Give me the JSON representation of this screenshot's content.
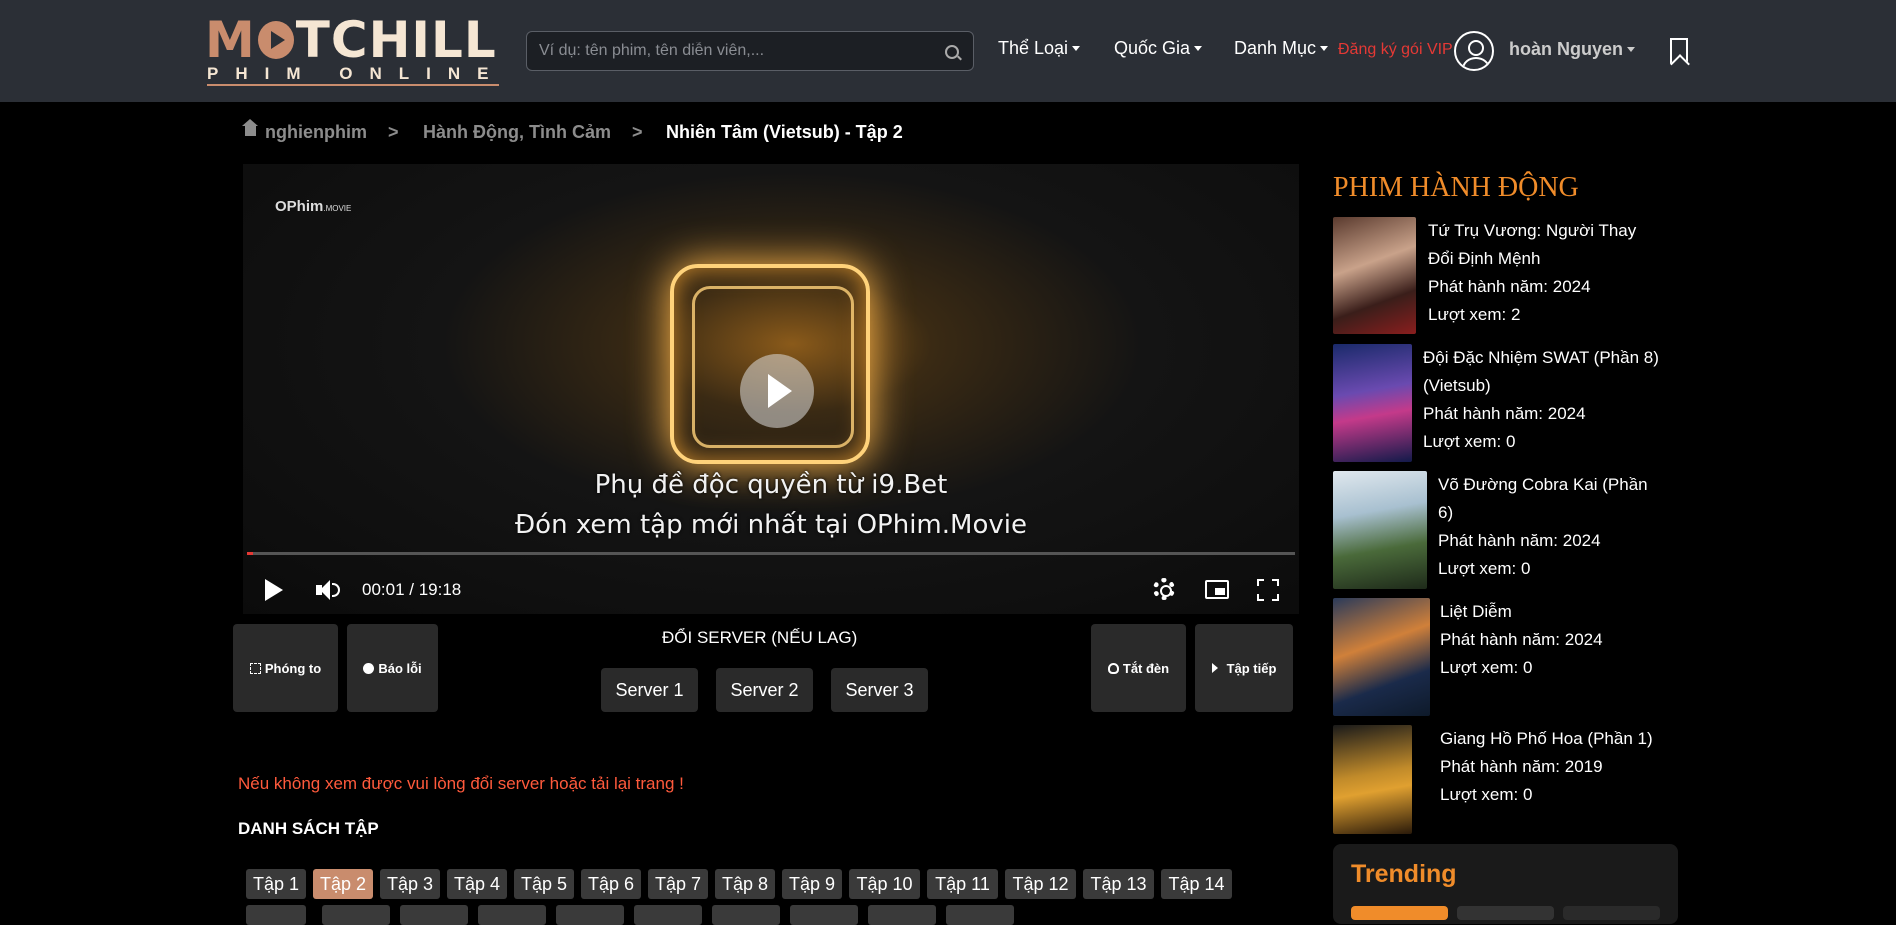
{
  "header": {
    "logo": {
      "main_left": "M",
      "main_right": "TCHILL",
      "sub": "PHIM ONLINE"
    },
    "search_placeholder": "Ví dụ: tên phim, tên diễn viên,...",
    "nav": [
      {
        "label": "Thể Loại"
      },
      {
        "label": "Quốc Gia"
      },
      {
        "label": "Danh Mục"
      }
    ],
    "vip_label": "Đăng ký gói VIP",
    "username": "hoàn Nguyen"
  },
  "breadcrumb": {
    "home": "nghienphim",
    "sep": ">",
    "category": "Hành Động, Tình Cảm",
    "current": "Nhiên Tâm (Vietsub) - Tập 2"
  },
  "player": {
    "brand": "OPhim",
    "brand_suffix": ".MOVIE",
    "subtitle_line1": "Phụ đề độc quyền từ i9.Bet",
    "subtitle_line2": "Đón xem tập mới nhất tại OPhim.Movie",
    "time": "00:01 / 19:18",
    "progress": 0.001
  },
  "tools": {
    "zoom": "Phóng to",
    "report": "Báo lỗi",
    "lights": "Tắt đèn",
    "next": "Tập tiếp"
  },
  "servers": {
    "title": "ĐỔI SERVER (NẾU LAG)",
    "items": [
      "Server 1",
      "Server 2",
      "Server 3"
    ]
  },
  "notice": "Nếu không xem được vui lòng đổi server hoặc tải lại trang !",
  "episodes": {
    "title": "DANH SÁCH TẬP",
    "items": [
      "Tập 1",
      "Tập 2",
      "Tập 3",
      "Tập 4",
      "Tập 5",
      "Tập 6",
      "Tập 7",
      "Tập 8",
      "Tập 9",
      "Tập 10",
      "Tập 11",
      "Tập 12",
      "Tập 13",
      "Tập 14"
    ],
    "active": "Tập 2"
  },
  "sidebar": {
    "title": "PHIM HÀNH ĐỘNG",
    "movies": [
      {
        "title_1": "Tứ Trụ Vương: Người Thay",
        "title_2": "Đổi Định Mệnh",
        "year": "Phát hành năm: 2024",
        "views": "Lượt xem: 2"
      },
      {
        "title_1": "Đội Đặc Nhiệm SWAT (Phần 8)",
        "title_2": "(Vietsub)",
        "year": "Phát hành năm: 2024",
        "views": "Lượt xem: 0"
      },
      {
        "title_1": "Võ Đường Cobra Kai (Phần",
        "title_2": "6)",
        "year": "Phát hành năm: 2024",
        "views": "Lượt xem: 0"
      },
      {
        "title_1": "Liệt Diễm",
        "title_2": "",
        "year": "Phát hành năm: 2024",
        "views": "Lượt xem: 0"
      },
      {
        "title_1": "Giang Hồ Phố Hoa (Phần 1)",
        "title_2": "",
        "year": "Phát hành năm: 2019",
        "views": "Lượt xem: 0"
      }
    ],
    "trending": "Trending"
  },
  "colors": {
    "header_bg": "#2b2f36",
    "accent_orange": "#f08c2a",
    "vip_red": "#e53935",
    "logo_copper": "#c98c6d",
    "button_bg": "#2a2a2a"
  }
}
